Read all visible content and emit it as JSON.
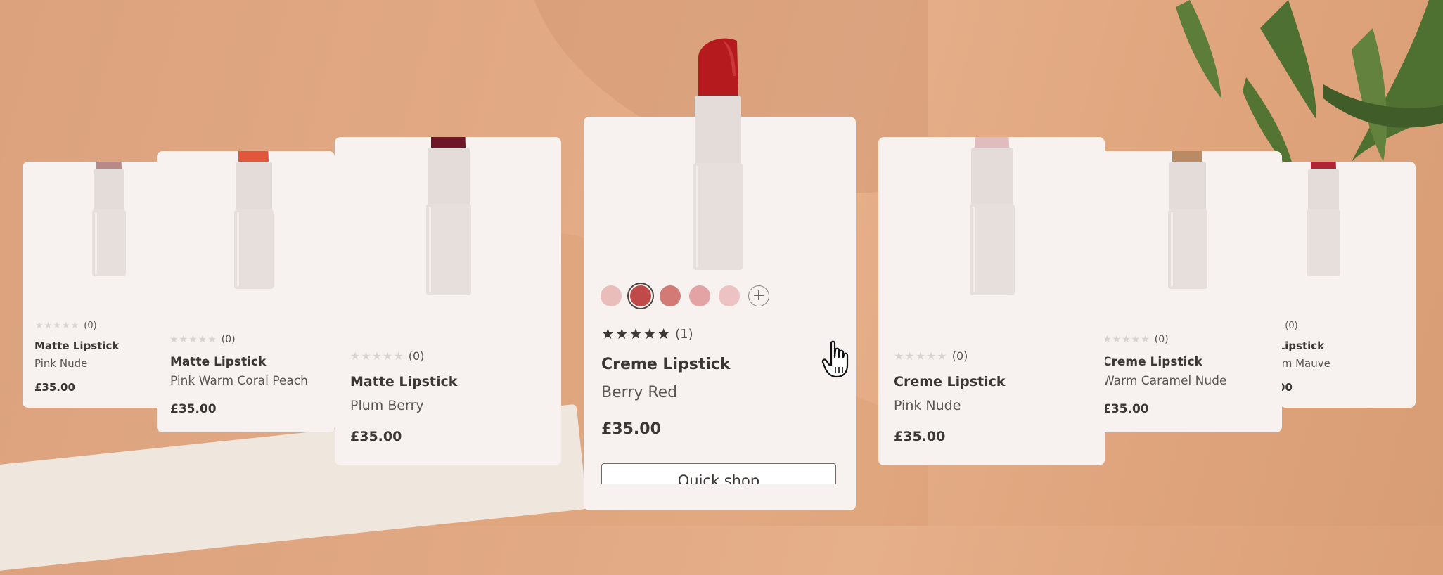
{
  "products": [
    {
      "name": "Matte Lipstick",
      "shade": "Pink Nude",
      "price": "£35.00",
      "count": "(0)",
      "stars": "★★★★★",
      "bullet": "#b98a85"
    },
    {
      "name": "Matte Lipstick",
      "shade": "Pink Warm Coral Peach",
      "price": "£35.00",
      "count": "(0)",
      "stars": "★★★★★",
      "bullet": "#e2573b"
    },
    {
      "name": "Matte Lipstick",
      "shade": "Plum Berry",
      "price": "£35.00",
      "count": "(0)",
      "stars": "★★★★★",
      "bullet": "#6e1628"
    },
    {
      "name": "Creme Lipstick",
      "shade": "Berry Red",
      "price": "£35.00",
      "count": "(1)",
      "stars": "★★★★★",
      "bullet": "#b51a1e"
    },
    {
      "name": "Creme Lipstick",
      "shade": "Pink Nude",
      "price": "£35.00",
      "count": "(0)",
      "stars": "★★★★★",
      "bullet": "#e0bcbf"
    },
    {
      "name": "Creme Lipstick",
      "shade": "Warm Caramel Nude",
      "price": "£35.00",
      "count": "(0)",
      "stars": "★★★★★",
      "bullet": "#b98a63"
    },
    {
      "name": "Creme Lipstick",
      "shade": "Plum Mauve",
      "price": "£35.00",
      "count": "(0)",
      "stars": "★★★★★",
      "bullet": "#b02436"
    }
  ],
  "featured": {
    "swatches": [
      "#e9bdb9",
      "#c0494a",
      "#d27a76",
      "#e3a2a4",
      "#ecc2c3"
    ],
    "add_more_icon": "plus-icon",
    "quick_shop_label": "Quick shop"
  },
  "colors": {
    "card_bg": "#f7f2f0",
    "text": "#3b3734",
    "star_empty": "#d9d3cf",
    "star_filled": "#3d3936"
  }
}
